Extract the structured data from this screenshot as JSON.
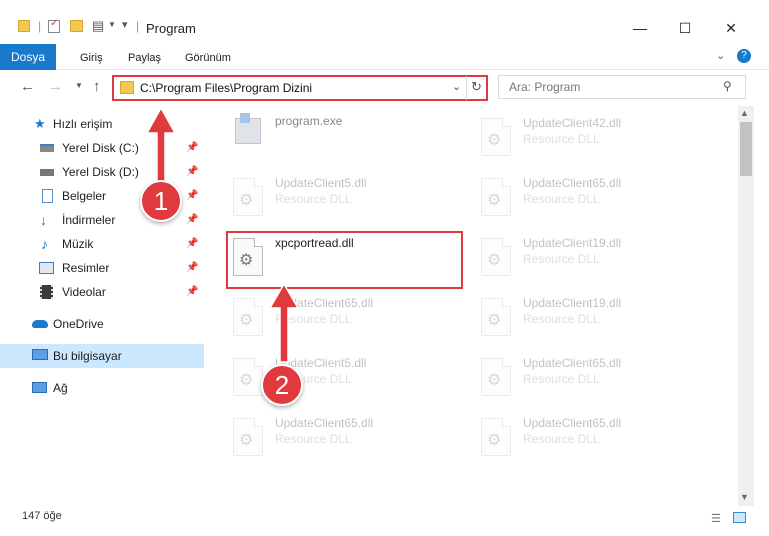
{
  "window": {
    "title": "Program"
  },
  "ribbon": {
    "tabs": [
      "Dosya",
      "Giriş",
      "Paylaş",
      "Görünüm"
    ]
  },
  "address": {
    "path": "C:\\Program Files\\Program Dizini"
  },
  "search": {
    "placeholder": "Ara: Program"
  },
  "sidebar": {
    "quick_access": "Hızlı erişim",
    "items": [
      "Yerel Disk (C:)",
      "Yerel Disk (D:)",
      "Belgeler",
      "İndirmeler",
      "Müzik",
      "Resimler",
      "Videolar"
    ],
    "onedrive": "OneDrive",
    "this_pc": "Bu bilgisayar",
    "network": "Ağ"
  },
  "files": {
    "col1": [
      {
        "name": "program.exe",
        "type": ""
      },
      {
        "name": "UpdateClient5.dll",
        "type": "Resource DLL"
      },
      {
        "name": "xpcportread.dll",
        "type": ""
      },
      {
        "name": "UpdateClient65.dll",
        "type": "Resource DLL"
      },
      {
        "name": "UpdateClient5.dll",
        "type": "Resource DLL"
      },
      {
        "name": "UpdateClient65.dll",
        "type": "Resource DLL"
      }
    ],
    "col2": [
      {
        "name": "UpdateClient42.dll",
        "type": "Resource DLL"
      },
      {
        "name": "UpdateClient65.dll",
        "type": "Resource DLL"
      },
      {
        "name": "UpdateClient19.dll",
        "type": "Resource DLL"
      },
      {
        "name": "UpdateClient19.dll",
        "type": "Resource DLL"
      },
      {
        "name": "UpdateClient65.dll",
        "type": "Resource DLL"
      },
      {
        "name": "UpdateClient65.dll",
        "type": "Resource DLL"
      }
    ]
  },
  "status": {
    "count": "147 öğe"
  },
  "annotations": {
    "step1": "1",
    "step2": "2"
  },
  "colors": {
    "accent": "#1979ca",
    "highlight": "#e0393e",
    "selected": "#cce8ff"
  }
}
